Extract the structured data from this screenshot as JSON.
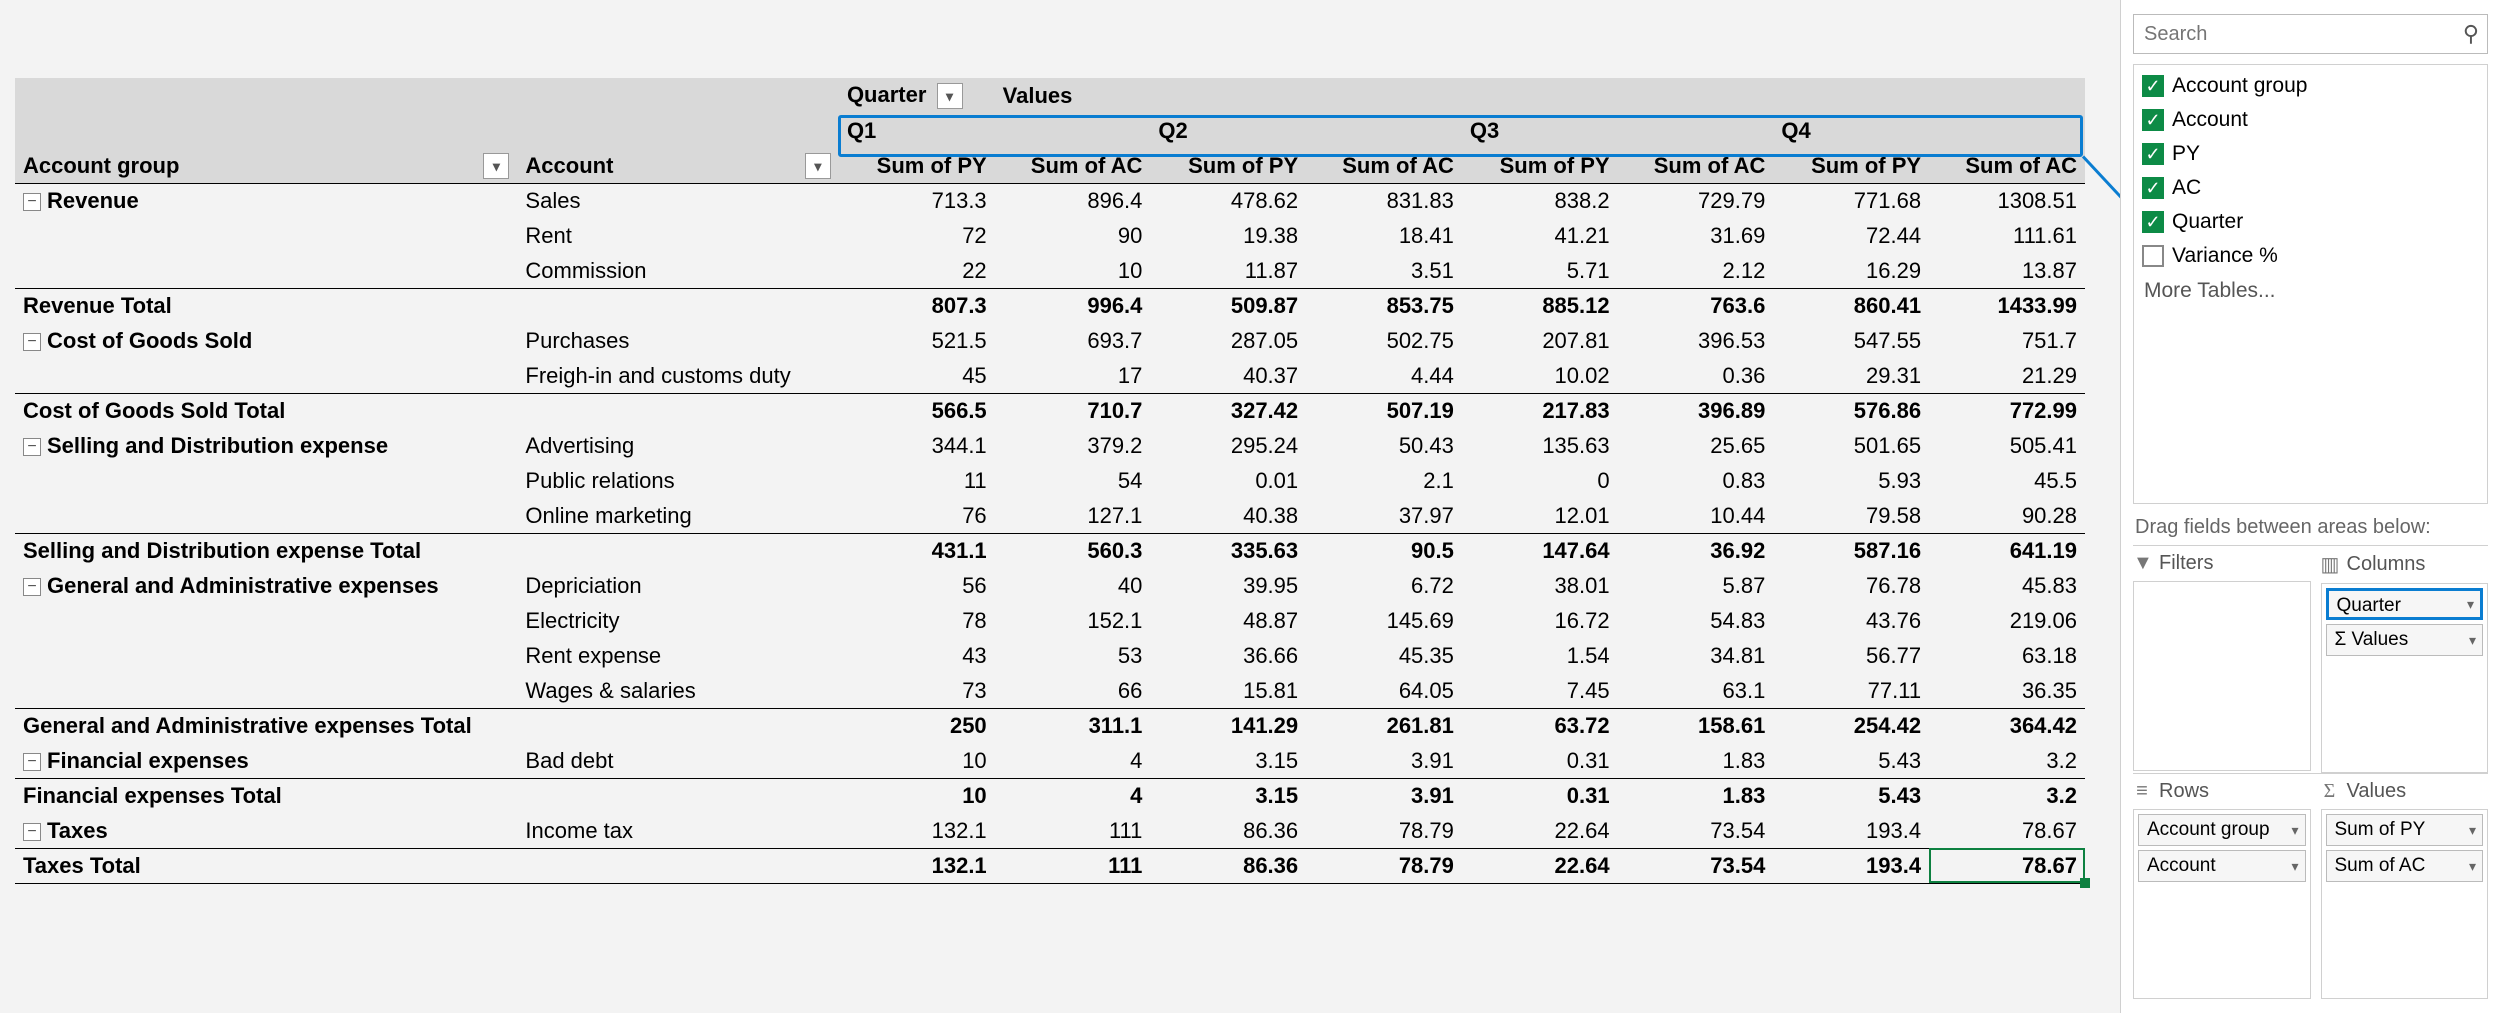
{
  "header": {
    "quarter_label": "Quarter",
    "values_label": "Values",
    "row_field1": "Account group",
    "row_field2": "Account",
    "quarters": [
      "Q1",
      "Q2",
      "Q3",
      "Q4"
    ],
    "measures": [
      "Sum of PY",
      "Sum of AC"
    ]
  },
  "groups": [
    {
      "name": "Revenue",
      "rows": [
        {
          "acct": "Sales",
          "v": [
            "713.3",
            "896.4",
            "478.62",
            "831.83",
            "838.2",
            "729.79",
            "771.68",
            "1308.51"
          ]
        },
        {
          "acct": "Rent",
          "v": [
            "72",
            "90",
            "19.38",
            "18.41",
            "41.21",
            "31.69",
            "72.44",
            "111.61"
          ]
        },
        {
          "acct": "Commission",
          "v": [
            "22",
            "10",
            "11.87",
            "3.51",
            "5.71",
            "2.12",
            "16.29",
            "13.87"
          ]
        }
      ],
      "total_label": "Revenue Total",
      "total": [
        "807.3",
        "996.4",
        "509.87",
        "853.75",
        "885.12",
        "763.6",
        "860.41",
        "1433.99"
      ]
    },
    {
      "name": "Cost of Goods Sold",
      "rows": [
        {
          "acct": "Purchases",
          "v": [
            "521.5",
            "693.7",
            "287.05",
            "502.75",
            "207.81",
            "396.53",
            "547.55",
            "751.7"
          ]
        },
        {
          "acct": "Freigh-in and customs duty",
          "v": [
            "45",
            "17",
            "40.37",
            "4.44",
            "10.02",
            "0.36",
            "29.31",
            "21.29"
          ]
        }
      ],
      "total_label": "Cost of Goods Sold Total",
      "total": [
        "566.5",
        "710.7",
        "327.42",
        "507.19",
        "217.83",
        "396.89",
        "576.86",
        "772.99"
      ]
    },
    {
      "name": "Selling and Distribution expense",
      "rows": [
        {
          "acct": "Advertising",
          "v": [
            "344.1",
            "379.2",
            "295.24",
            "50.43",
            "135.63",
            "25.65",
            "501.65",
            "505.41"
          ]
        },
        {
          "acct": "Public relations",
          "v": [
            "11",
            "54",
            "0.01",
            "2.1",
            "0",
            "0.83",
            "5.93",
            "45.5"
          ]
        },
        {
          "acct": "Online marketing",
          "v": [
            "76",
            "127.1",
            "40.38",
            "37.97",
            "12.01",
            "10.44",
            "79.58",
            "90.28"
          ]
        }
      ],
      "total_label": "Selling and Distribution expense Total",
      "total": [
        "431.1",
        "560.3",
        "335.63",
        "90.5",
        "147.64",
        "36.92",
        "587.16",
        "641.19"
      ]
    },
    {
      "name": "General and Administrative expenses",
      "rows": [
        {
          "acct": "Depriciation",
          "v": [
            "56",
            "40",
            "39.95",
            "6.72",
            "38.01",
            "5.87",
            "76.78",
            "45.83"
          ]
        },
        {
          "acct": "Electricity",
          "v": [
            "78",
            "152.1",
            "48.87",
            "145.69",
            "16.72",
            "54.83",
            "43.76",
            "219.06"
          ]
        },
        {
          "acct": "Rent expense",
          "v": [
            "43",
            "53",
            "36.66",
            "45.35",
            "1.54",
            "34.81",
            "56.77",
            "63.18"
          ]
        },
        {
          "acct": "Wages & salaries",
          "v": [
            "73",
            "66",
            "15.81",
            "64.05",
            "7.45",
            "63.1",
            "77.11",
            "36.35"
          ]
        }
      ],
      "total_label": "General and Administrative expenses Total",
      "total": [
        "250",
        "311.1",
        "141.29",
        "261.81",
        "63.72",
        "158.61",
        "254.42",
        "364.42"
      ]
    },
    {
      "name": "Financial expenses",
      "rows": [
        {
          "acct": "Bad debt",
          "v": [
            "10",
            "4",
            "3.15",
            "3.91",
            "0.31",
            "1.83",
            "5.43",
            "3.2"
          ]
        }
      ],
      "total_label": "Financial expenses Total",
      "total": [
        "10",
        "4",
        "3.15",
        "3.91",
        "0.31",
        "1.83",
        "5.43",
        "3.2"
      ]
    },
    {
      "name": "Taxes",
      "rows": [
        {
          "acct": "Income tax",
          "v": [
            "132.1",
            "111",
            "86.36",
            "78.79",
            "22.64",
            "73.54",
            "193.4",
            "78.67"
          ]
        }
      ],
      "total_label": "Taxes Total",
      "total": [
        "132.1",
        "111",
        "86.36",
        "78.79",
        "22.64",
        "73.54",
        "193.4",
        "78.67"
      ]
    }
  ],
  "panel": {
    "search_placeholder": "Search",
    "fields": [
      {
        "label": "Account group",
        "checked": true
      },
      {
        "label": "Account",
        "checked": true
      },
      {
        "label": "PY",
        "checked": true
      },
      {
        "label": "AC",
        "checked": true
      },
      {
        "label": "Quarter",
        "checked": true
      },
      {
        "label": "Variance %",
        "checked": false
      }
    ],
    "more_tables": "More Tables...",
    "hint": "Drag fields between areas below:",
    "areas": {
      "filters": "Filters",
      "columns": "Columns",
      "rows": "Rows",
      "values": "Values"
    },
    "columns_items": [
      "Quarter",
      "Σ Values"
    ],
    "rows_items": [
      "Account group",
      "Account"
    ],
    "values_items": [
      "Sum of PY",
      "Sum of AC"
    ]
  }
}
